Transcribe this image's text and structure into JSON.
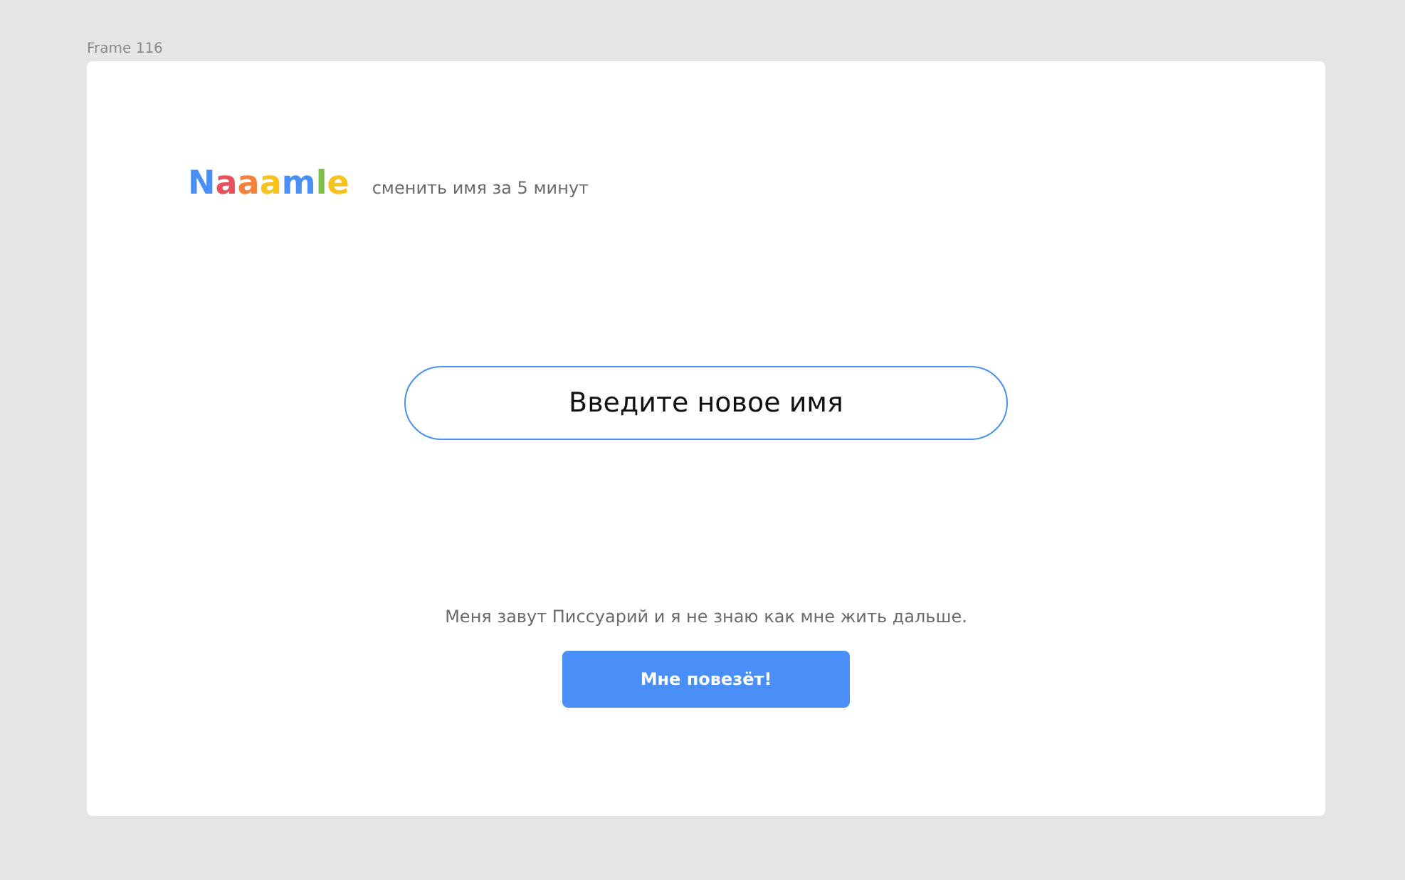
{
  "frame_label": "Frame 116",
  "logo": {
    "letters": [
      {
        "text": "N",
        "color": "#4a8ff5"
      },
      {
        "text": "a",
        "color": "#e8505b"
      },
      {
        "text": "a",
        "color": "#f5813a"
      },
      {
        "text": "a",
        "color": "#f7c21c"
      },
      {
        "text": "m",
        "color": "#4a8ff5"
      },
      {
        "text": "l",
        "color": "#7cc04a"
      },
      {
        "text": "e",
        "color": "#f7c21c"
      }
    ]
  },
  "tagline": "сменить имя за 5 минут",
  "name_field": {
    "placeholder": "Введите новое имя"
  },
  "description": "Меня завут Писсуарий и я не знаю как мне жить дальше.",
  "button": "Мне повезёт!"
}
